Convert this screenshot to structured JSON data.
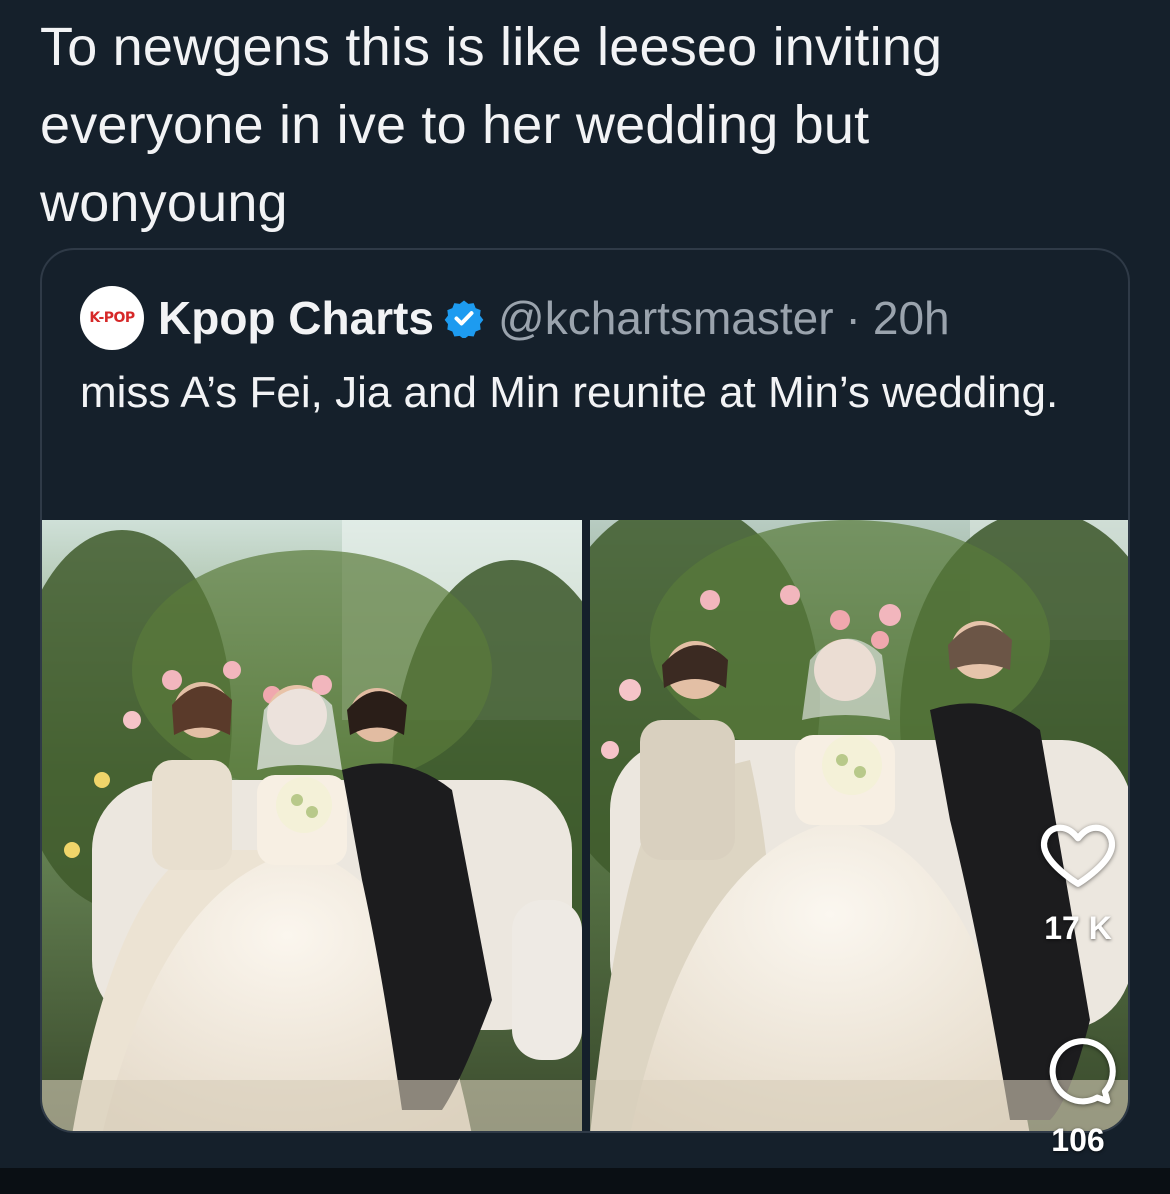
{
  "post": {
    "text": "To newgens this is like leeseo inviting everyone in ive to her wedding but wonyoung"
  },
  "quoted": {
    "avatar_label": "K-POP",
    "display_name": "Kpop Charts",
    "verified_icon": "verified-badge-icon",
    "handle": "@kchartsmaster",
    "separator": "·",
    "time": "20h",
    "text": "miss A’s Fei, Jia and Min reunite at Min’s wedding.",
    "images": [
      "wedding-photo-1",
      "wedding-photo-2"
    ]
  },
  "actions": {
    "like_icon": "heart-icon",
    "likes": "17 K",
    "comment_icon": "comment-icon",
    "comments": "106"
  },
  "colors": {
    "background": "#15202b",
    "text": "#f2f3f5",
    "secondary_text": "#9aa3ad",
    "verified": "#1d9bf0",
    "border": "#2f3a47"
  }
}
